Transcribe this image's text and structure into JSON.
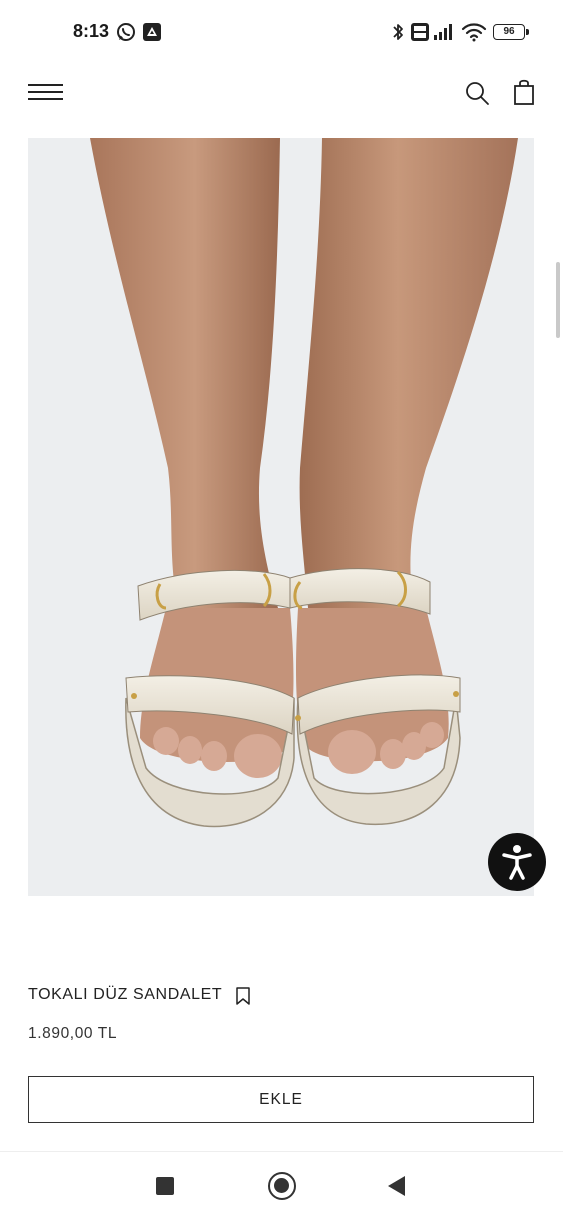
{
  "status_bar": {
    "time": "8:13",
    "battery": "96",
    "icons": [
      "whatsapp-icon",
      "app-notification-icon",
      "bluetooth-icon",
      "volte-icon",
      "signal-icon",
      "wifi-icon",
      "battery-icon"
    ]
  },
  "header": {
    "icons": [
      "hamburger-menu-icon",
      "search-icon",
      "shopping-bag-icon"
    ]
  },
  "product": {
    "name": "TOKALI DÜZ SANDALET",
    "price": "1.890,00 TL",
    "add_label": "EKLE",
    "image": "product-photo-sandals"
  },
  "navigation": {
    "icons": [
      "recents-icon",
      "home-icon",
      "back-icon"
    ]
  },
  "colors": {
    "background": "#ffffff",
    "text": "#222222",
    "image_background": "#eceef0",
    "sandal": "#eae4d6",
    "accessibility_button": "#111111"
  }
}
